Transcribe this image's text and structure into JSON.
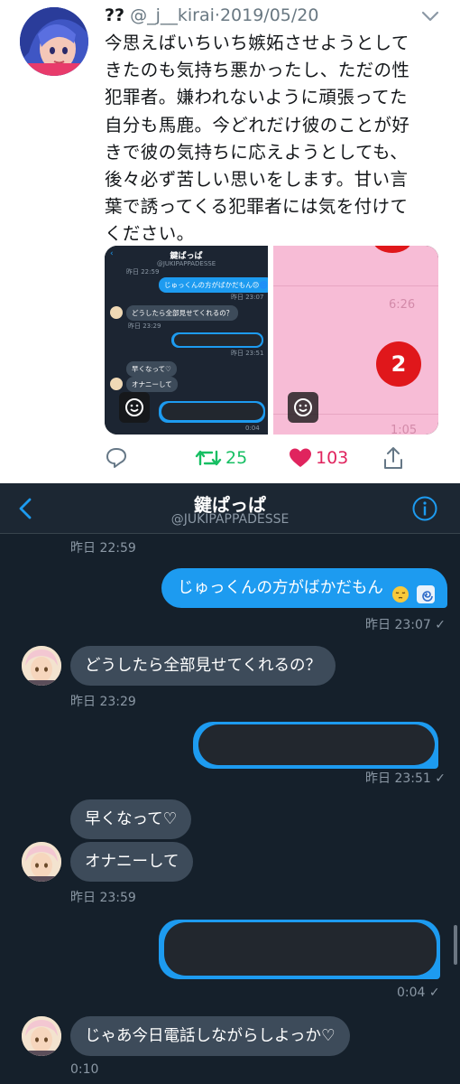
{
  "tweet": {
    "display_name": "??",
    "handle": "@_j__kirai",
    "separator": "·",
    "date": "2019/05/20",
    "text_lines": [
      "今思えばいちいち嫉妬させようとして",
      "きたのも気持ち悪かったし、ただの性",
      "犯罪者。嫌われないように頑張ってた",
      "自分も馬鹿。今どれだけ彼のことが好",
      "きで彼の気持ちに応えようとしても、",
      "後々必ず苦しい思いをします。甘い言",
      "葉で誘ってくる犯罪者には気を付けて",
      "ください。"
    ],
    "media": {
      "left": {
        "title": "鍵ぱっぱ",
        "handle": "@JUKIPAPPADESSE",
        "stamp_1": "昨日 22:59",
        "out_1": "じゅっくんの方がばかだもん😔🌀",
        "stamp_2": "昨日 23:07",
        "in_1": "どうしたら全部見せてくれるの？",
        "stamp_3": "昨日 23:29",
        "stamp_4": "昨日 23:51",
        "in_2": "早くなって♡",
        "in_3": "オナニーして",
        "stamp_5": "0:04"
      },
      "right": {
        "time": "6:26",
        "badge": "2",
        "time_partial": "1:05"
      }
    },
    "actions": {
      "retweets": "25",
      "likes": "103"
    },
    "colors": {
      "retweet": "#17bf63",
      "like": "#e0245e",
      "icon": "#657786"
    }
  },
  "dm": {
    "title": "鍵ぱっぱ",
    "handle": "@JUKIPAPPADESSE",
    "messages": {
      "stamp_top": "昨日 22:59",
      "out_1_text": "じゅっくんの方がばかだもん",
      "out_1_stamp": "昨日 23:07",
      "in_1_text": "どうしたら全部見せてくれるの？",
      "in_1_stamp": "昨日 23:29",
      "out_2_stamp": "昨日 23:51",
      "in_2_text": "早くなって♡",
      "in_3_text": "オナニーして",
      "in_3_stamp": "昨日 23:59",
      "out_3_stamp": "0:04",
      "in_4_text": "じゃあ今日電話しながらしよっか♡",
      "in_4_stamp": "0:10"
    },
    "read_mark": "✓",
    "colors": {
      "background": "#15202b",
      "accent": "#1d9bf0",
      "incoming": "#3d4b5a"
    }
  }
}
